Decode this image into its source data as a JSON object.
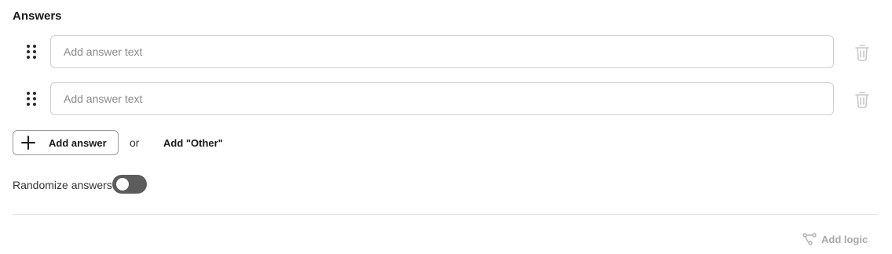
{
  "section": {
    "title": "Answers"
  },
  "answers": [
    {
      "value": "",
      "placeholder": "Add answer text"
    },
    {
      "value": "",
      "placeholder": "Add answer text"
    }
  ],
  "actions": {
    "add_answer_label": "Add answer",
    "or_text": "or",
    "add_other_label": "Add \"Other\""
  },
  "randomize": {
    "label": "Randomize answers",
    "enabled": false
  },
  "footer": {
    "add_logic_label": "Add logic"
  },
  "icons": {
    "drag": "drag-handle-icon",
    "delete": "trash-icon",
    "add": "plus-icon",
    "logic": "logic-branch-icon"
  },
  "colors": {
    "toggle_off": "#5c5c5c",
    "disabled_text": "#a8a8a8",
    "input_border": "#cfcfcf"
  }
}
